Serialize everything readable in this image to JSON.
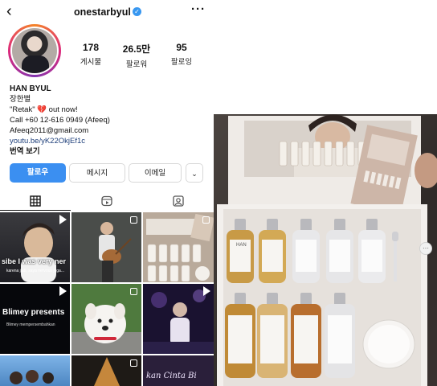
{
  "profile": {
    "username": "onestarbyul",
    "verified_icon": "verified-badge-icon",
    "stats": [
      {
        "value": "178",
        "label": "게시물"
      },
      {
        "value": "26.5만",
        "label": "팔로워"
      },
      {
        "value": "95",
        "label": "팔로잉"
      }
    ],
    "bio": {
      "name": "HAN BYUL",
      "korean_name": "장한별",
      "line_retak": "\"Retak\" 💔 out now!",
      "line_call": "Call +60 12-616 0949 (Afeeq)",
      "email": "Afeeq2011@gmail.com",
      "link": "youtu.be/yK22OkjEf1c",
      "translate": "번역 보기"
    },
    "buttons": {
      "follow": "팔로우",
      "message": "메시지",
      "email": "이메일",
      "more": "⌄"
    },
    "tabs": [
      "grid-icon",
      "reels-icon",
      "tagged-icon"
    ],
    "grid_captions": {
      "tile1_main": "sibe I was very ner",
      "tile1_small": "karena jadi, saya nervous juga...",
      "tile4_main": "Blimey presents",
      "tile4_small": "Blimey mempersembahkan",
      "tile9_main": "kan Cinta Bi"
    }
  },
  "photo": {
    "bottle_label": "HAN"
  },
  "colors": {
    "follow_button": "#3b8ff1",
    "link_text": "#1e3f7a",
    "verified": "#3897f0"
  }
}
